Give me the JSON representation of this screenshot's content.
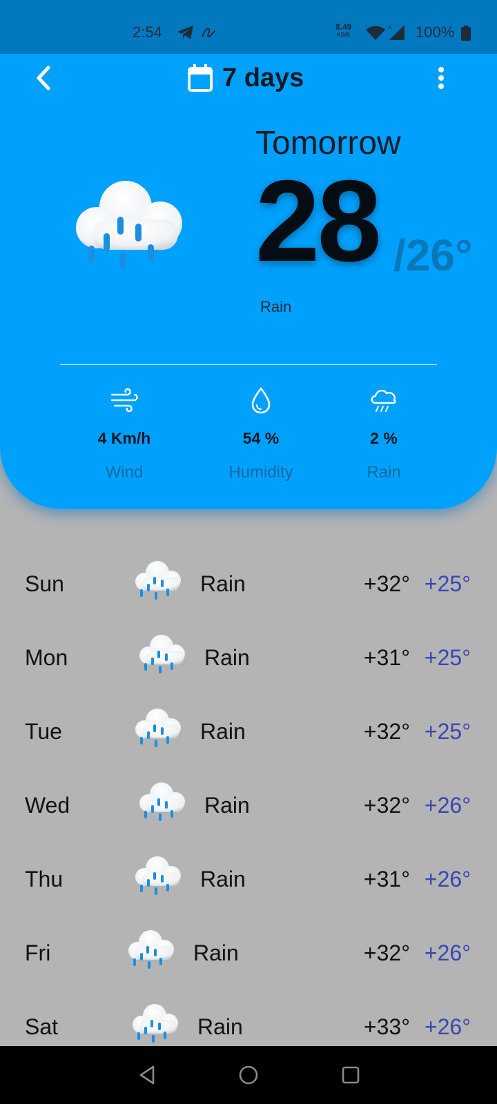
{
  "status_bar": {
    "time": "2:54",
    "net_speed": "8.49",
    "net_unit": "KB/S",
    "battery": "100%",
    "icons": [
      "telegram-icon",
      "app-notification-icon",
      "wifi-icon",
      "signal-icon",
      "battery-icon"
    ]
  },
  "header": {
    "title": "7 days",
    "icons": [
      "back-icon",
      "calendar-icon",
      "more-vert-icon"
    ]
  },
  "current": {
    "day": "Tomorrow",
    "high": "28",
    "low": "/26°",
    "condition": "Rain",
    "icon": "rain-cloud-icon"
  },
  "stats": [
    {
      "icon": "wind-icon",
      "value": "4 Km/h",
      "label": "Wind"
    },
    {
      "icon": "droplet-icon",
      "value": "54 %",
      "label": "Humidity"
    },
    {
      "icon": "rain-icon",
      "value": "2 %",
      "label": "Rain"
    }
  ],
  "forecast": [
    {
      "day": "Sun",
      "condition": "Rain",
      "high": "+32°",
      "low": "+25°"
    },
    {
      "day": "Mon",
      "condition": "Rain",
      "high": "+31°",
      "low": "+25°"
    },
    {
      "day": "Tue",
      "condition": "Rain",
      "high": "+32°",
      "low": "+25°"
    },
    {
      "day": "Wed",
      "condition": "Rain",
      "high": "+32°",
      "low": "+26°"
    },
    {
      "day": "Thu",
      "condition": "Rain",
      "high": "+31°",
      "low": "+26°"
    },
    {
      "day": "Fri",
      "condition": "Rain",
      "high": "+32°",
      "low": "+26°"
    },
    {
      "day": "Sat",
      "condition": "Rain",
      "high": "+33°",
      "low": "+26°"
    }
  ],
  "colors": {
    "card": "#00a1fd",
    "status_bar": "#0278bf",
    "background": "#b4b4b4",
    "low_temp": "#3a46b4",
    "rain_drop": "#1a8fe0"
  },
  "nav": {
    "icons": [
      "nav-back-icon",
      "nav-home-icon",
      "nav-recent-icon"
    ]
  }
}
